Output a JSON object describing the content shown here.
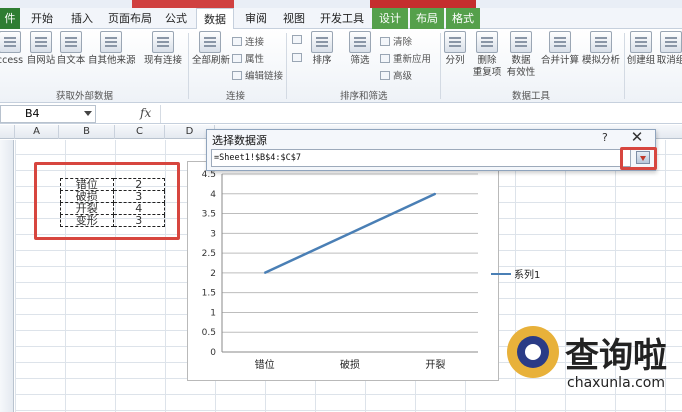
{
  "tabs": [
    {
      "label": "件",
      "kind": "file"
    },
    {
      "label": "开始"
    },
    {
      "label": "插入"
    },
    {
      "label": "页面布局"
    },
    {
      "label": "公式"
    },
    {
      "label": "数据",
      "active": true
    },
    {
      "label": "审阅"
    },
    {
      "label": "视图"
    },
    {
      "label": "开发工具"
    },
    {
      "label": "设计",
      "kind": "ctx"
    },
    {
      "label": "布局",
      "kind": "ctx"
    },
    {
      "label": "格式",
      "kind": "ctx"
    }
  ],
  "ribbon": {
    "get_external": {
      "buttons": [
        "ccess",
        "自网站",
        "自文本",
        "自其他来源",
        "现有连接"
      ],
      "label": "获取外部数据"
    },
    "connections": {
      "refresh": "全部刷新",
      "small": [
        "连接",
        "属性",
        "编辑链接"
      ],
      "label": "连接"
    },
    "sort_filter": {
      "sort": "排序",
      "filter": "筛选",
      "small": [
        "清除",
        "重新应用",
        "高级"
      ],
      "label": "排序和筛选"
    },
    "data_tools": {
      "buttons": [
        "分列",
        "删除\n重复项",
        "数据\n有效性",
        "合并计算",
        "模拟分析"
      ],
      "label": "数据工具"
    },
    "outline": {
      "buttons": [
        "创建组",
        "取消组"
      ]
    }
  },
  "formula_bar": {
    "name_box": "B4",
    "fx": "fx"
  },
  "columns": [
    "A",
    "B",
    "C",
    "D"
  ],
  "table": [
    {
      "label": "错位",
      "value": "2"
    },
    {
      "label": "破损",
      "value": "3"
    },
    {
      "label": "开裂",
      "value": "4"
    },
    {
      "label": "变形",
      "value": "3"
    }
  ],
  "chart_data": {
    "type": "line",
    "categories": [
      "错位",
      "破损",
      "开裂"
    ],
    "series": [
      {
        "name": "系列1",
        "values": [
          2,
          3,
          4
        ],
        "color": "#4a7fb5"
      }
    ],
    "ylim": [
      0,
      4.5
    ],
    "yticks": [
      "0",
      "0.5",
      "1",
      "1.5",
      "2",
      "2.5",
      "3",
      "3.5",
      "4",
      "4.5"
    ],
    "grid": true,
    "legend_position": "right"
  },
  "dialog": {
    "title": "选择数据源",
    "help": "?",
    "close": "✕",
    "range": "=Sheet1!$B$4:$C$7"
  },
  "watermark": {
    "text": "查询啦",
    "domain": "chaxunla.com"
  },
  "colors": {
    "accent_red": "#d7463f",
    "series": "#4a7fb5",
    "file_tab": "#2e7d32"
  }
}
